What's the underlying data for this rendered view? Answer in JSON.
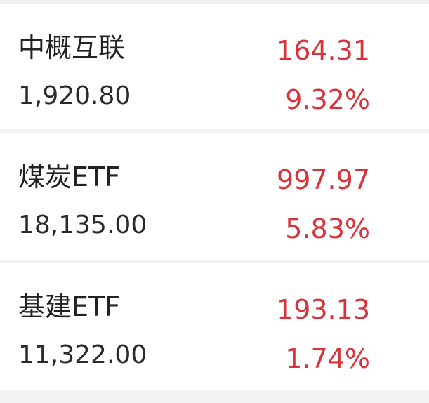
{
  "colors": {
    "background": "#f2f2f2",
    "card": "#ffffff",
    "positive": "#d8323a",
    "text_primary": "#222222"
  },
  "items": [
    {
      "name": "中概互联",
      "amount": "1,920.80",
      "price": "164.31",
      "change_pct": "9.32%"
    },
    {
      "name": "煤炭ETF",
      "amount": "18,135.00",
      "price": "997.97",
      "change_pct": "5.83%"
    },
    {
      "name": "基建ETF",
      "amount": "11,322.00",
      "price": "193.13",
      "change_pct": "1.74%"
    }
  ]
}
